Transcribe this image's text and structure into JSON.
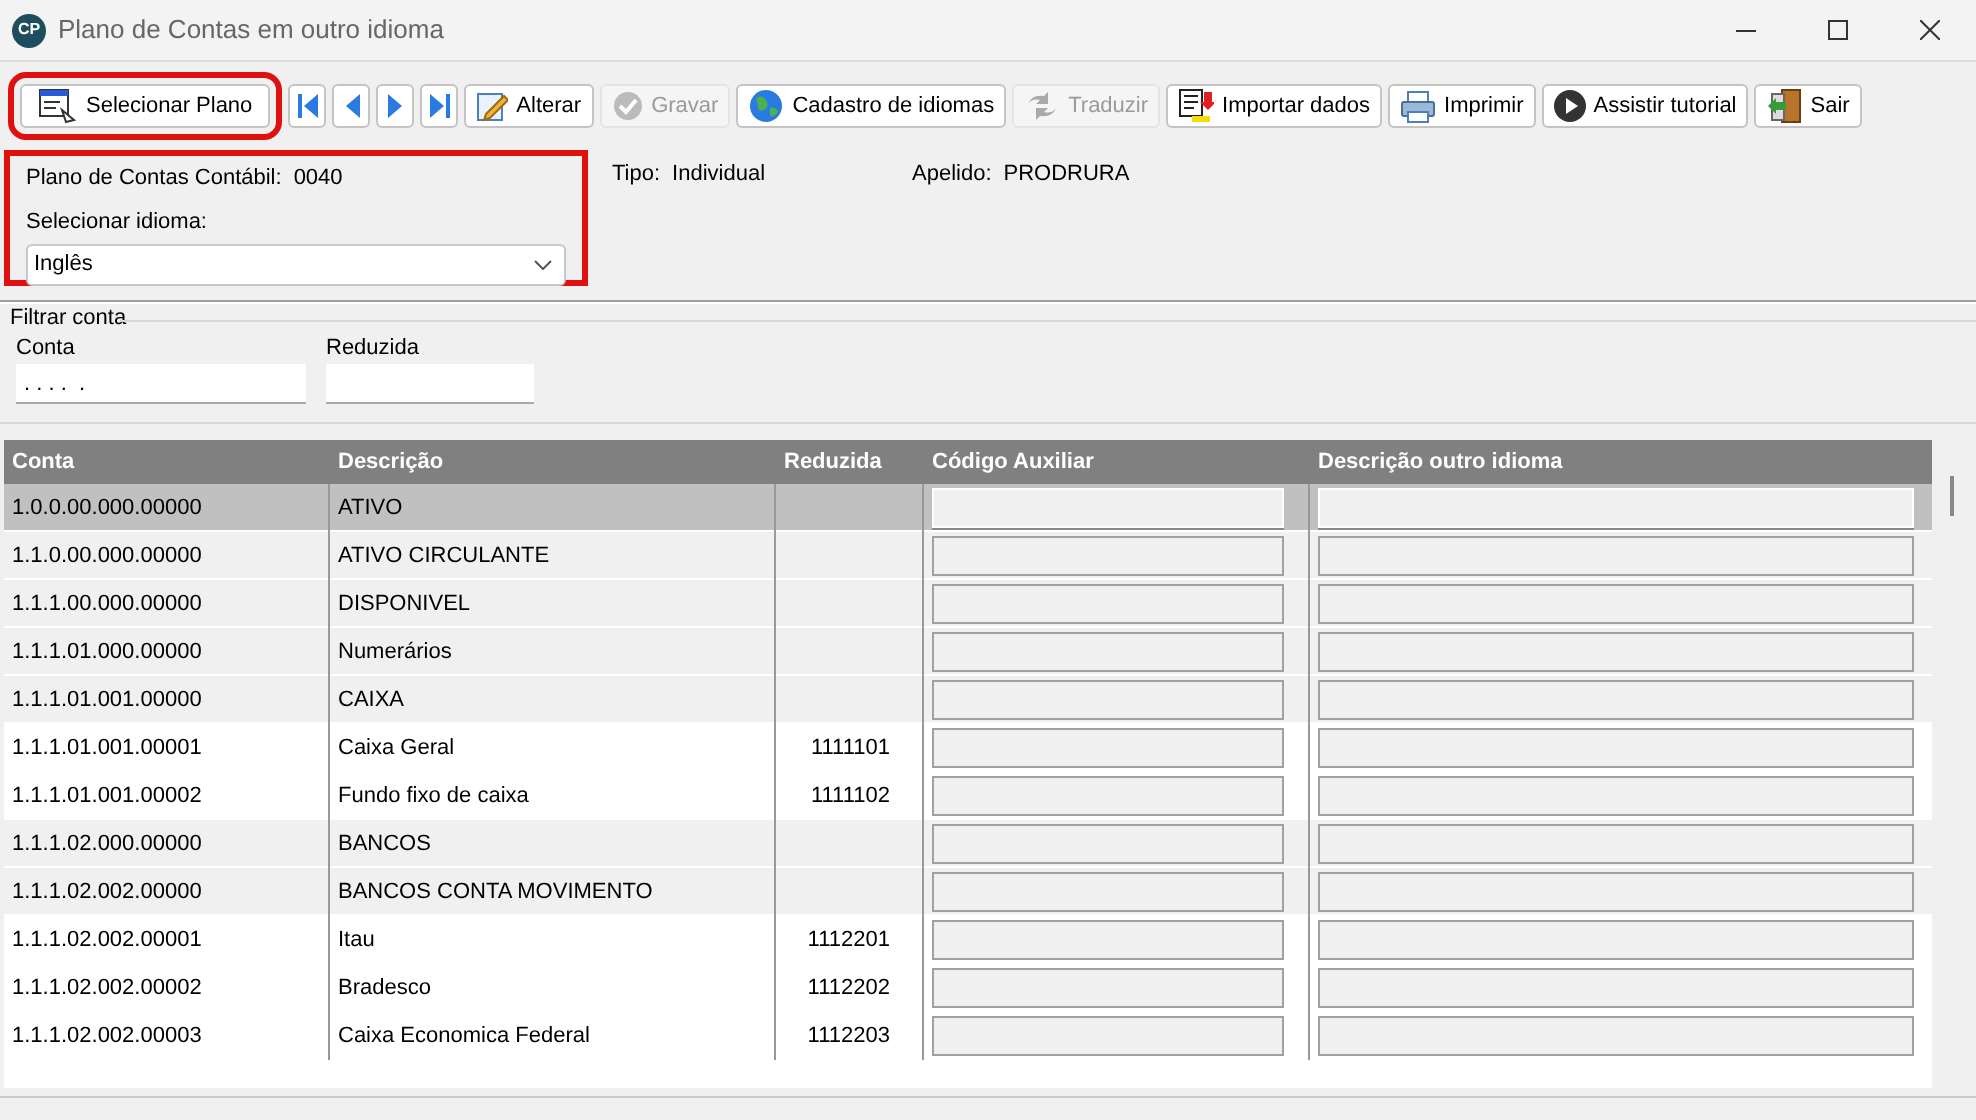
{
  "window": {
    "title": "Plano de Contas em outro idioma",
    "app_badge": "CP"
  },
  "toolbar": [
    {
      "kind": "text",
      "label": "Selecionar Plano",
      "disabled": false,
      "highlighted": true
    },
    {
      "kind": "nav",
      "disabled": false,
      "highlighted": false
    },
    {
      "kind": "nav",
      "disabled": false,
      "highlighted": false
    },
    {
      "kind": "nav",
      "disabled": false,
      "highlighted": false
    },
    {
      "kind": "nav",
      "disabled": false,
      "highlighted": false
    },
    {
      "kind": "text",
      "label": "Alterar",
      "disabled": false,
      "highlighted": false
    },
    {
      "kind": "text",
      "label": "Gravar",
      "disabled": true,
      "highlighted": false
    },
    {
      "kind": "text",
      "label": "Cadastro de idiomas",
      "disabled": false,
      "highlighted": false
    },
    {
      "kind": "text",
      "label": "Traduzir",
      "disabled": true,
      "highlighted": false
    },
    {
      "kind": "text",
      "label": "Importar dados",
      "disabled": false,
      "highlighted": false
    },
    {
      "kind": "text",
      "label": "Imprimir",
      "disabled": false,
      "highlighted": false
    },
    {
      "kind": "text",
      "label": "Assistir tutorial",
      "disabled": false,
      "highlighted": false
    },
    {
      "kind": "text",
      "label": "Sair",
      "disabled": false,
      "highlighted": false
    }
  ],
  "info": {
    "highlighted": true,
    "plan_label": "Plano de Contas Contábil:",
    "plan_value": "0040",
    "language_label": "Selecionar idioma:",
    "language_value": "Inglês",
    "type_label": "Tipo:",
    "type_value": "Individual",
    "alias_label": "Apelido:",
    "alias_value": "PRODRURA"
  },
  "filter": {
    "title": "Filtrar conta",
    "fields": [
      {
        "label": "Conta",
        "value": ". . . .  ."
      },
      {
        "label": "Reduzida"
      }
    ]
  },
  "table": {
    "columns": [
      "Conta",
      "Descrição",
      "Reduzida",
      "Código Auxiliar",
      "Descrição outro idioma"
    ],
    "rows": [
      {
        "kind": "synthetic",
        "selected": true,
        "conta": "1.0.0.00.000.00000",
        "descricao": "ATIVO"
      },
      {
        "kind": "synthetic",
        "selected": false,
        "conta": "1.1.0.00.000.00000",
        "descricao": "ATIVO CIRCULANTE"
      },
      {
        "kind": "synthetic",
        "selected": false,
        "conta": "1.1.1.00.000.00000",
        "descricao": "DISPONIVEL"
      },
      {
        "kind": "synthetic",
        "selected": false,
        "conta": "1.1.1.01.000.00000",
        "descricao": "Numerários"
      },
      {
        "kind": "synthetic",
        "selected": false,
        "conta": "1.1.1.01.001.00000",
        "descricao": "CAIXA"
      },
      {
        "kind": "analytic",
        "selected": false,
        "conta": "1.1.1.01.001.00001",
        "descricao": "Caixa Geral",
        "reduzida": "1111101"
      },
      {
        "kind": "analytic",
        "selected": false,
        "conta": "1.1.1.01.001.00002",
        "descricao": "Fundo fixo de caixa",
        "reduzida": "1111102"
      },
      {
        "kind": "synthetic",
        "selected": false,
        "conta": "1.1.1.02.000.00000",
        "descricao": "BANCOS"
      },
      {
        "kind": "synthetic",
        "selected": false,
        "conta": "1.1.1.02.002.00000",
        "descricao": "BANCOS CONTA MOVIMENTO"
      },
      {
        "kind": "analytic",
        "selected": false,
        "conta": "1.1.1.02.002.00001",
        "descricao": "Itau",
        "reduzida": "1112201"
      },
      {
        "kind": "analytic",
        "selected": false,
        "conta": "1.1.1.02.002.00002",
        "descricao": "Bradesco",
        "reduzida": "1112202"
      },
      {
        "kind": "analytic",
        "selected": false,
        "conta": "1.1.1.02.002.00003",
        "descricao": "Caixa Economica Federal",
        "reduzida": "1112203"
      }
    ]
  }
}
